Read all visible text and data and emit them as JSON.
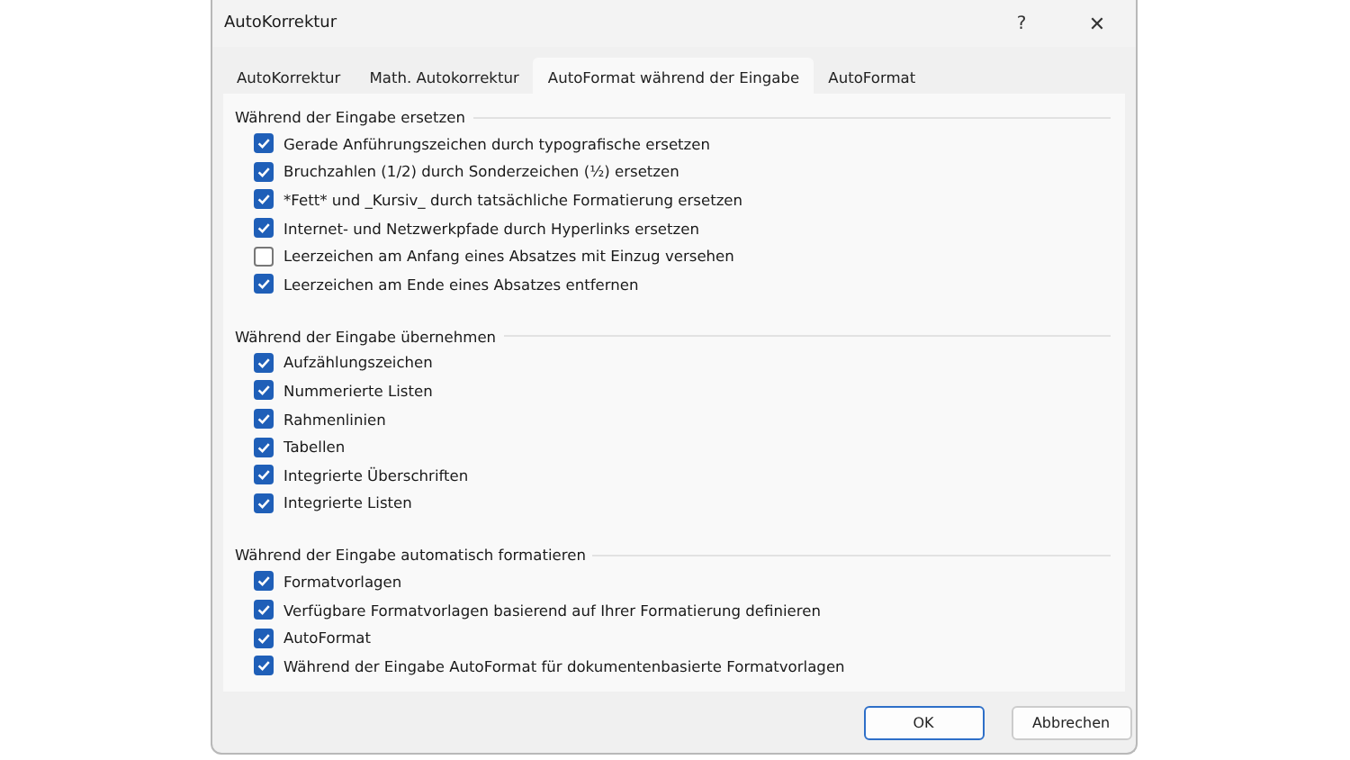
{
  "window": {
    "title": "AutoKorrektur",
    "help": "?",
    "close": "✕"
  },
  "tabs": [
    {
      "label": "AutoKorrektur",
      "selected": false
    },
    {
      "label": "Math. Autokorrektur",
      "selected": false
    },
    {
      "label": "AutoFormat während der Eingabe",
      "selected": true
    },
    {
      "label": "AutoFormat",
      "selected": false
    }
  ],
  "sections": [
    {
      "title": "Während der Eingabe ersetzen",
      "options": [
        {
          "label": "Gerade Anführungszeichen durch typografische ersetzen",
          "checked": true
        },
        {
          "label": "Bruchzahlen (1/2) durch Sonderzeichen (½) ersetzen",
          "checked": true
        },
        {
          "label": "*Fett* und _Kursiv_ durch tatsächliche Formatierung ersetzen",
          "checked": true
        },
        {
          "label": "Internet- und Netzwerkpfade durch Hyperlinks ersetzen",
          "checked": true
        },
        {
          "label": "Leerzeichen am Anfang eines Absatzes mit Einzug versehen",
          "checked": false
        },
        {
          "label": "Leerzeichen am Ende eines Absatzes entfernen",
          "checked": true
        }
      ]
    },
    {
      "title": "Während der Eingabe übernehmen",
      "options": [
        {
          "label": "Aufzählungszeichen",
          "checked": true
        },
        {
          "label": "Nummerierte Listen",
          "checked": true
        },
        {
          "label": "Rahmenlinien",
          "checked": true
        },
        {
          "label": "Tabellen",
          "checked": true
        },
        {
          "label": "Integrierte Überschriften",
          "checked": true
        },
        {
          "label": "Integrierte Listen",
          "checked": true
        }
      ]
    },
    {
      "title": "Während der Eingabe automatisch formatieren",
      "options": [
        {
          "label": "Formatvorlagen",
          "checked": true
        },
        {
          "label": "Verfügbare Formatvorlagen basierend auf Ihrer Formatierung definieren",
          "checked": true
        },
        {
          "label": "AutoFormat",
          "checked": true
        },
        {
          "label": "Während der Eingabe AutoFormat für dokumentenbasierte Formatvorlagen",
          "checked": true
        }
      ]
    }
  ],
  "buttons": [
    {
      "label": "OK",
      "kind": "default"
    },
    {
      "label": "Abbrechen",
      "kind": "normal"
    }
  ]
}
